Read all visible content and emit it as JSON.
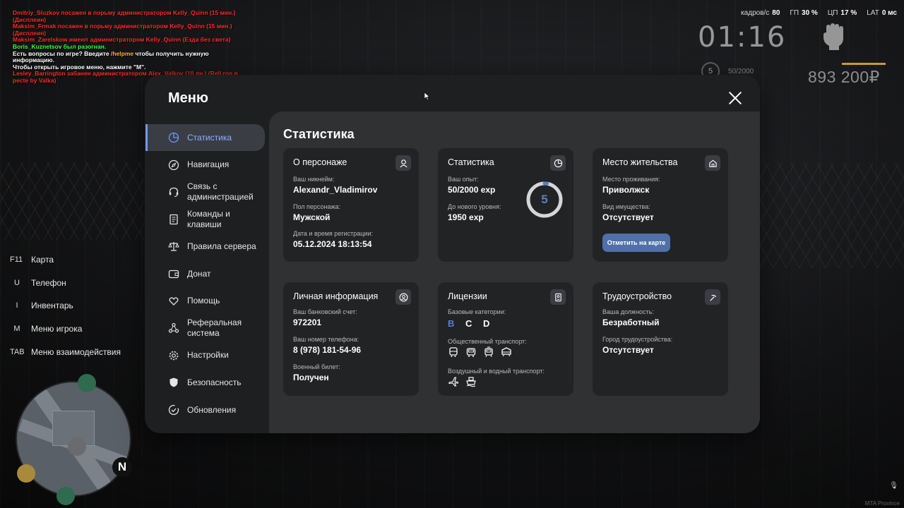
{
  "chat": [
    {
      "text": "Dmitriy_Sluzkov посажен в порьму администратором Kelly_Quinn (15 мин.)",
      "color": "red"
    },
    {
      "text": "(Дисплеин)",
      "color": "red"
    },
    {
      "text": "Maksim_Frmak посажен в порьму администратором Kelly_Quinn (15 мин.)",
      "color": "red"
    },
    {
      "text": "(Дисплеин)",
      "color": "red"
    },
    {
      "text": "Maksim_Zarelskow имеют администратором Kelly_Quinn (Езда без света)",
      "color": "red"
    },
    {
      "text": "Boris_Kuznetsov был разогнан.",
      "color": "green"
    },
    {
      "text": "Есть вопросы по игре? Введите /helpme чтобы получить нужную информацию.",
      "color": "white"
    },
    {
      "text": "Чтобы открыть игровое меню, нажмите \"M\".",
      "color": "white"
    },
    {
      "text": "Lesley_Barrington забанен администратором Alex_Valkov (10 дн.) (Rell ron в",
      "color": "red"
    },
    {
      "text": "pecte by Valka)",
      "color": "red"
    }
  ],
  "hud": {
    "fps_label": "кадров/с",
    "fps": "80",
    "gpu_label": "ГП",
    "gpu": "30 %",
    "cpu_label": "ЦП",
    "cpu": "17 %",
    "lat_label": "LAT",
    "lat": "0 мс",
    "clock": "01:16",
    "level": "5",
    "exp": "50/2000",
    "money": "893 200₽"
  },
  "keybinds": [
    {
      "key": "F11",
      "label": "Карта"
    },
    {
      "key": "U",
      "label": "Телефон"
    },
    {
      "key": "I",
      "label": "Инвентарь"
    },
    {
      "key": "M",
      "label": "Меню игрока"
    },
    {
      "key": "TAB",
      "label": "Меню взаимодействия"
    }
  ],
  "minimap": {
    "north": "N"
  },
  "footer": {
    "server": "MTA Province"
  },
  "menu": {
    "title": "Меню",
    "nav": [
      {
        "label": "Статистика",
        "icon": "pie-chart-icon",
        "active": true
      },
      {
        "label": "Навигация",
        "icon": "compass-icon"
      },
      {
        "label": "Связь с администрацией",
        "icon": "headset-icon"
      },
      {
        "label": "Команды и клавиши",
        "icon": "document-icon"
      },
      {
        "label": "Правила сервера",
        "icon": "scales-icon"
      },
      {
        "label": "Донат",
        "icon": "wallet-icon"
      },
      {
        "label": "Помощь",
        "icon": "heart-hands-icon"
      },
      {
        "label": "Реферальная система",
        "icon": "network-icon"
      },
      {
        "label": "Настройки",
        "icon": "gear-icon"
      },
      {
        "label": "Безопасность",
        "icon": "shield-icon"
      },
      {
        "label": "Обновления",
        "icon": "check-circle-icon"
      }
    ],
    "section_title": "Статистика",
    "character": {
      "title": "О персонаже",
      "nick_label": "Ваш никнейм:",
      "nick": "Alexandr_Vladimirov",
      "gender_label": "Пол персонажа:",
      "gender": "Мужской",
      "reg_label": "Дата и время регистрации:",
      "reg": "05.12.2024 18:13:54"
    },
    "stats": {
      "title": "Статистика",
      "exp_label": "Ваш опыт:",
      "exp": "50/2000 exp",
      "next_label": "До нового уровня:",
      "next": "1950 exp",
      "level": "5",
      "progress": 0.025
    },
    "residence": {
      "title": "Место жительства",
      "place_label": "Место проживания:",
      "place": "Приволжск",
      "property_label": "Вид имущества:",
      "property": "Отсутствует",
      "button": "Отметить на карте"
    },
    "personal": {
      "title": "Личная информация",
      "bank_label": "Ваш банковский счет:",
      "bank": "972201",
      "phone_label": "Ваш номер телефона:",
      "phone": "8 (978) 181-54-96",
      "military_label": "Военный билет:",
      "military": "Получен"
    },
    "licenses": {
      "title": "Лицензии",
      "basic_label": "Базовые категории:",
      "basic": [
        "B",
        "C",
        "D"
      ],
      "public_label": "Общественный транспорт:",
      "public_icons": [
        "bus-icon",
        "trolleybus-icon",
        "tram-icon",
        "train-icon"
      ],
      "air_label": "Воздушный и водный транспорт:",
      "air_icons": [
        "plane-icon",
        "ship-icon"
      ]
    },
    "job": {
      "title": "Трудоустройство",
      "position_label": "Ваша должность:",
      "position": "Безработный",
      "city_label": "Город трудоустройства:",
      "city": "Отсутствует"
    }
  },
  "colors": {
    "accent": "#6f98ff",
    "button": "#4f70a8",
    "panel": "#1e1f21",
    "content": "#303133",
    "card": "#222325"
  }
}
